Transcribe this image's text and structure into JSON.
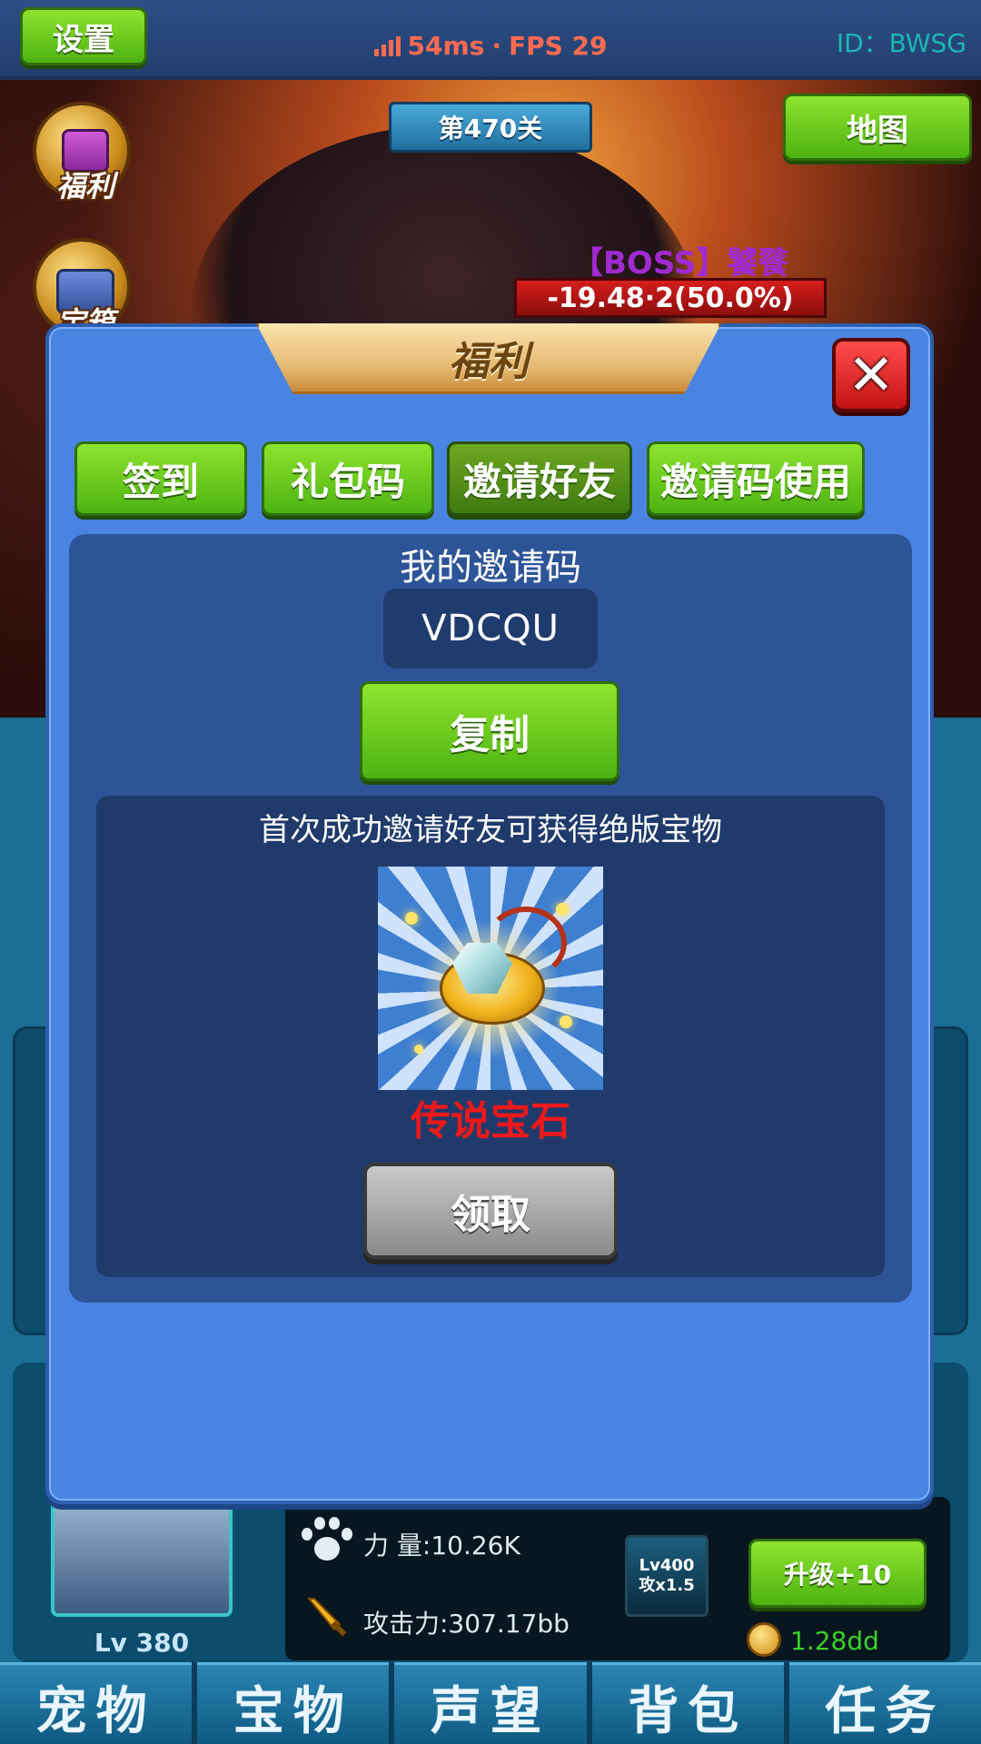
{
  "topbar": {
    "settings_label": "设置",
    "latency": "54ms",
    "separator": "·",
    "fps": "FPS 29",
    "user_id": "ID：BWSG"
  },
  "scene": {
    "stage": "第470关",
    "map_label": "地图",
    "side_icons": [
      {
        "label": "福利",
        "icon": "gift-box-icon"
      },
      {
        "label": "宝箱",
        "icon": "treasure-chest-icon"
      }
    ],
    "boss_name": "【BOSS】饕餮",
    "boss_hp_text": "-19.48·2(50.0%)"
  },
  "pet": {
    "level": "Lv 380",
    "power_label": "力  量:10.26K",
    "attack_label": "攻击力:307.17bb",
    "skill_level": "Lv400",
    "skill_mult": "攻x1.5",
    "upgrade_label": "升级+10",
    "coin_value": "1.28dd"
  },
  "bottom_nav": {
    "tabs": [
      "宠物",
      "宝物",
      "声望",
      "背包",
      "任务"
    ]
  },
  "modal": {
    "title": "福利",
    "close_icon": "close-icon",
    "tabs": [
      {
        "label": "签到",
        "active": false
      },
      {
        "label": "礼包码",
        "active": false
      },
      {
        "label": "邀请好友",
        "active": true
      },
      {
        "label": "邀请码使用",
        "active": false
      }
    ],
    "invite_title": "我的邀请码",
    "invite_code": "VDCQU",
    "copy_label": "复制",
    "reward_desc": "首次成功邀请好友可获得绝版宝物",
    "reward_name": "传说宝石",
    "reward_icon": "legendary-gem-icon",
    "claim_label": "领取"
  },
  "colors": {
    "accent_green": "#6fd11e",
    "modal_blue": "#4a84e2",
    "reward_red": "#f0191b",
    "boss_purple": "#a02bd1"
  }
}
